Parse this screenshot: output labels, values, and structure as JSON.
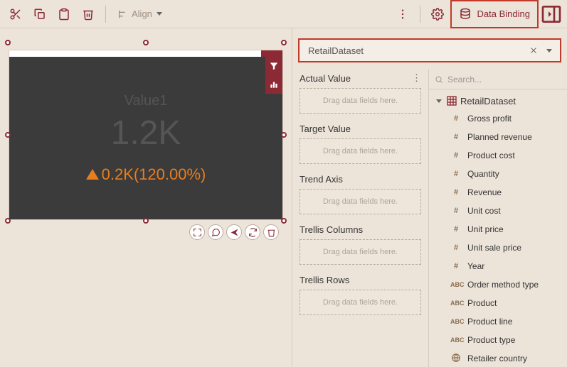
{
  "toolbar": {
    "align_label": "Align",
    "data_binding_label": "Data Binding"
  },
  "dataset": {
    "name": "RetailDataset"
  },
  "widget": {
    "title": "Value1",
    "value": "1.2K",
    "delta": "0.2K(120.00%)"
  },
  "dropzones": {
    "drag_hint": "Drag data fields here.",
    "items": [
      {
        "label": "Actual Value",
        "has_more": true
      },
      {
        "label": "Target Value",
        "has_more": false
      },
      {
        "label": "Trend Axis",
        "has_more": false
      },
      {
        "label": "Trellis Columns",
        "has_more": false
      },
      {
        "label": "Trellis Rows",
        "has_more": false
      }
    ]
  },
  "fields": {
    "search_placeholder": "Search...",
    "root": "RetailDataset",
    "items": [
      {
        "type": "num",
        "name": "Gross profit"
      },
      {
        "type": "num",
        "name": "Planned revenue"
      },
      {
        "type": "num",
        "name": "Product cost"
      },
      {
        "type": "num",
        "name": "Quantity"
      },
      {
        "type": "num",
        "name": "Revenue"
      },
      {
        "type": "num",
        "name": "Unit cost"
      },
      {
        "type": "num",
        "name": "Unit price"
      },
      {
        "type": "num",
        "name": "Unit sale price"
      },
      {
        "type": "num",
        "name": "Year"
      },
      {
        "type": "abc",
        "name": "Order method type"
      },
      {
        "type": "abc",
        "name": "Product"
      },
      {
        "type": "abc",
        "name": "Product line"
      },
      {
        "type": "abc",
        "name": "Product type"
      },
      {
        "type": "geo",
        "name": "Retailer country"
      }
    ]
  }
}
